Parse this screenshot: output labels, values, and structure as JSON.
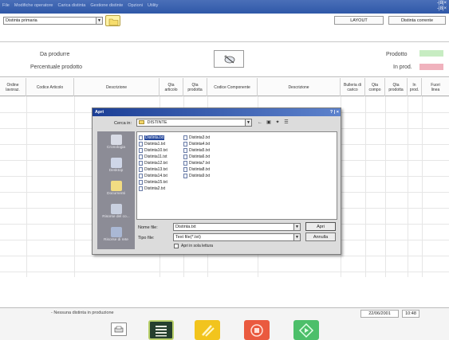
{
  "titlebar": {
    "menus": [
      "File",
      "Modifiche operatore",
      "Carica distinta",
      "Gestione distinte",
      "Opzioni",
      "Utility"
    ],
    "window_controls": [
      "-|8|×",
      "-|8|×"
    ]
  },
  "toolbar": {
    "distinta_select": "Distinta primaria",
    "layout_label": "LAYOUT",
    "distinta_corrente_label": "Distinta corrente"
  },
  "header": {
    "da_produrre": "Da produrre",
    "percentuale_prodotto": "Percentuale prodotto",
    "prodotto": "Prodotto",
    "in_prod": "In prod.",
    "colors": {
      "prodotto": "#c7ecc2",
      "in_prod": "#f0b2bd"
    }
  },
  "table": {
    "columns": [
      "Ordine\nlavoraz.",
      "Codice Articolo",
      "Descrizione",
      "Qta\narticolo",
      "Qta\nprodotta",
      "Codice Componente",
      "Descrizione",
      "Bulleria di\ncarico",
      "Qta\ncompo",
      "Qta\nprodotta",
      "In\nprod.",
      "Fuori\nlinea"
    ]
  },
  "dialog": {
    "title": "Apri",
    "help": "? | ×",
    "cerca_in_label": "Cerca in:",
    "cerca_in_value": "DISTINTE",
    "places": [
      "Cronologia",
      "Desktop",
      "Documenti",
      "Risorse del co...",
      "Risorse di rete"
    ],
    "files": [
      "Distinta.txt",
      "Distinta1.txt",
      "Distinta10.txt",
      "Distinta11.txt",
      "Distinta12.txt",
      "Distinta13.txt",
      "Distinta14.txt",
      "Distinta15.txt",
      "Distinta2.txt",
      "Distinta3.txt",
      "Distinta4.txt",
      "Distinta5.txt",
      "Distinta6.txt",
      "Distinta7.txt",
      "Distinta8.txt",
      "Distinta9.txt"
    ],
    "selected_file": "Distinta.txt",
    "nome_file_label": "Nome file:",
    "nome_file_value": "Distinta.txt",
    "tipo_file_label": "Tipo file:",
    "tipo_file_value": "Text file(*.txt)",
    "apri_label": "Apri",
    "annulla_label": "Annulla",
    "sola_lettura_label": "Apri in sola lettura"
  },
  "status": {
    "message": "- Nessuna distinta in produzione",
    "date": "22/06/2001",
    "time": "10:48"
  },
  "bottom_buttons": [
    {
      "name": "list-icon",
      "color": "#26402f"
    },
    {
      "name": "edit-icon",
      "color": "#f2c41d"
    },
    {
      "name": "stop-icon",
      "color": "#ea5a3f"
    },
    {
      "name": "start-icon",
      "color": "#4dbf6a"
    }
  ]
}
